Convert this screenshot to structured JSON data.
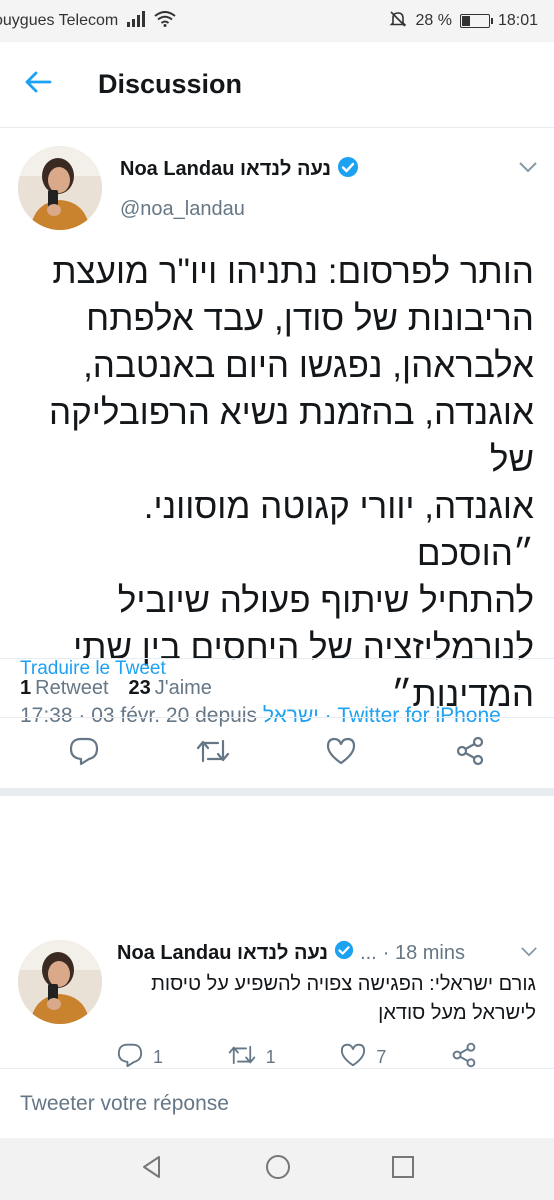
{
  "status_bar": {
    "carrier": "ouygues Telecom",
    "battery_percent": "28 %",
    "battery_level": 0.28,
    "time": "18:01"
  },
  "header": {
    "title": "Discussion"
  },
  "tweet": {
    "author_name": "Noa Landau נעה לנדאו",
    "author_handle": "@noa_landau",
    "verified": true,
    "text_lines": [
      "הותר לפרסום: נתניהו ויו\"ר מועצת",
      "הריבונות של סודן, עבד אלפתח",
      "אלבראהן, נפגשו היום באנטבה,",
      "אוגנדה, בהזמנת נשיא הרפובליקה של",
      "אוגנדה, יוורי קגוטה מוסווני. ״הוסכם",
      "להתחיל שיתוף פעולה שיוביל",
      "לנורמליזציה של היחסים בין שתי",
      "המדינות״"
    ],
    "translate_label": "Traduire le Tweet",
    "meta_time": "17:38 · 03 févr. 20 depuis ",
    "meta_location": "ישראל",
    "meta_separator": " · ",
    "meta_source": "Twitter for iPhone",
    "retweet_count": "1",
    "retweet_label": "Retweet",
    "like_count": "23",
    "like_label": "J'aime"
  },
  "reply": {
    "author_name": "Noa Landau נעה לנדאו",
    "verified": true,
    "ellipsis": "...",
    "time": "· 18 mins",
    "text": "גורם ישראלי: הפגישה צפויה להשפיע על טיסות לישראל מעל סודאן",
    "reply_count": "1",
    "retweet_count": "1",
    "like_count": "7"
  },
  "composer": {
    "placeholder": "Tweeter votre réponse"
  },
  "colors": {
    "accent": "#1da1f2",
    "secondary_text": "#657786",
    "divider": "#e6ecf0"
  },
  "icons": [
    "back-arrow-icon",
    "verified-badge-icon",
    "chevron-down-icon",
    "reply-icon",
    "retweet-icon",
    "like-icon",
    "share-icon",
    "nav-back-icon",
    "nav-home-icon",
    "nav-recents-icon"
  ]
}
